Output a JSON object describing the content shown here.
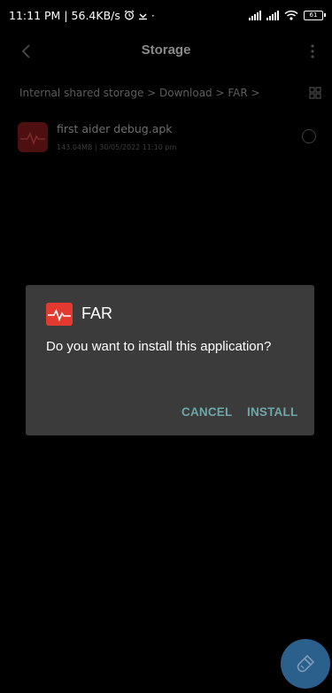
{
  "status_bar": {
    "time": "11:11 PM",
    "speed": "56.4KB/s",
    "battery": "61"
  },
  "app_bar": {
    "title": "Storage"
  },
  "breadcrumb": "Internal shared storage > Download > FAR >",
  "file": {
    "name": "first aider debug.apk",
    "meta": "143.04MB | 30/05/2022 11:10 pm"
  },
  "dialog": {
    "app_name": "FAR",
    "message": "Do you want to install this application?",
    "cancel_label": "CANCEL",
    "install_label": "INSTALL"
  },
  "colors": {
    "dialog_bg": "#3b3b3b",
    "accent": "#6fa6a8",
    "app_icon": "#e23a2f",
    "fab": "#2b5f8c"
  },
  "icons": [
    "back-icon",
    "more-icon",
    "grid-icon",
    "heartbeat-icon",
    "brush-icon",
    "alarm-icon",
    "download-icon",
    "signal-icon",
    "wifi-icon",
    "battery-icon"
  ]
}
